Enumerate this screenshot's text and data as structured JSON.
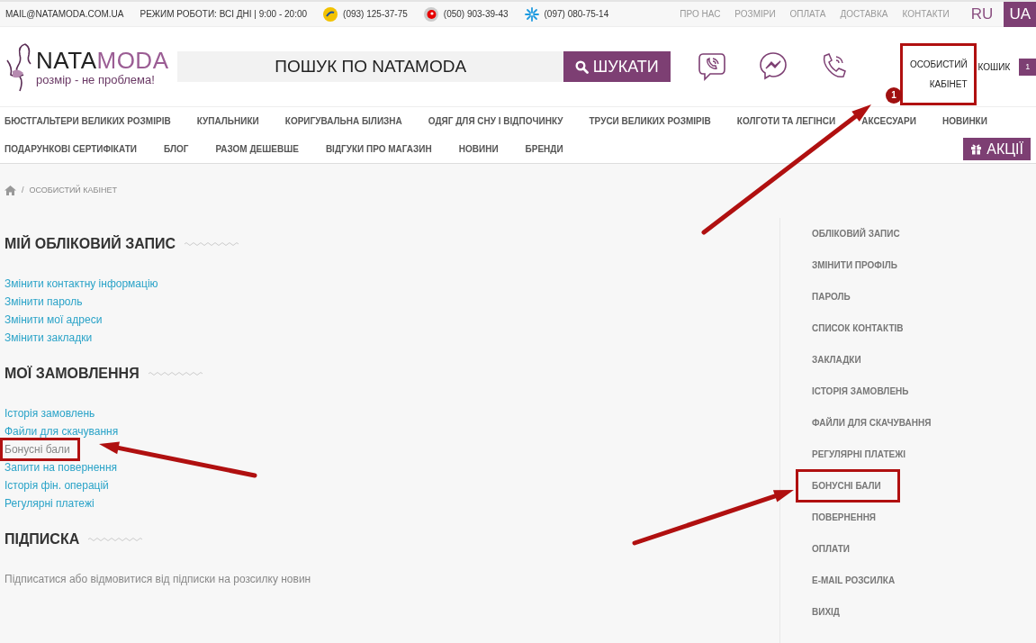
{
  "top_bar": {
    "email": "MAIL@NATAMODA.COM.UA",
    "hours": "РЕЖИМ РОБОТИ: ВСІ ДНІ | 9:00 - 20:00",
    "phones": [
      {
        "kind": "swoosh",
        "number": "(093) 125-37-75"
      },
      {
        "kind": "drop",
        "number": "(050) 903-39-43"
      },
      {
        "kind": "star",
        "number": "(097) 080-75-14"
      }
    ],
    "links": [
      "ПРО НАС",
      "РОЗМІРИ",
      "ОПЛАТА",
      "ДОСТАВКА",
      "КОНТАКТИ"
    ],
    "languages": [
      {
        "label": "RU",
        "selected": false
      },
      {
        "label": "UA",
        "selected": true
      }
    ]
  },
  "header": {
    "logo": {
      "name_start": "NATA",
      "name_end": "MODA",
      "tagline": "розмір - не проблема!"
    },
    "search": {
      "placeholder": "ПОШУК ПО NATAMODA",
      "button": "ШУКАТИ"
    },
    "account_link": {
      "label": "ОСОБИСТИЙ КАБІНЕТ",
      "highlighted": true
    },
    "step_marker": "1",
    "cart": {
      "label": "КОШИК",
      "count": "1"
    }
  },
  "nav": {
    "categories": [
      "БЮСТГАЛЬТЕРИ ВЕЛИКИХ РОЗМІРІВ",
      "КУПАЛЬНИКИ",
      "КОРИГУВАЛЬНА БІЛИЗНА",
      "ОДЯГ ДЛЯ СНУ І ВІДПОЧИНКУ",
      "ТРУСИ ВЕЛИКИХ РОЗМІРІВ",
      "КОЛГОТИ ТА ЛЕГІНСИ",
      "АКСЕСУАРИ",
      "НОВИНКИ"
    ],
    "extra_links": [
      "ПОДАРУНКОВІ СЕРТИФІКАТИ",
      "БЛОГ",
      "РАЗОМ ДЕШЕВШЕ",
      "ВІДГУКИ ПРО МАГАЗИН",
      "НОВИНИ",
      "БРЕНДИ"
    ],
    "promo_button": "АКЦІЇ"
  },
  "breadcrumb": {
    "separator": "/",
    "current": "ОСОБИСТИЙ КАБІНЕТ"
  },
  "sections": [
    {
      "title": "МІЙ ОБЛІКОВИЙ ЗАПИС",
      "links": [
        {
          "label": "Змінити контактну інформацію",
          "selected": false,
          "highlighted": false
        },
        {
          "label": "Змінити пароль",
          "selected": false,
          "highlighted": false
        },
        {
          "label": "Змінити мої адреси",
          "selected": false,
          "highlighted": false
        },
        {
          "label": "Змінити закладки",
          "selected": false,
          "highlighted": false
        }
      ]
    },
    {
      "title": "МОЇ ЗАМОВЛЕННЯ",
      "links": [
        {
          "label": "Історія замовлень",
          "selected": false,
          "highlighted": false
        },
        {
          "label": "Файли для скачування",
          "selected": false,
          "highlighted": false
        },
        {
          "label": "Бонусні бали",
          "selected": true,
          "highlighted": true
        },
        {
          "label": "Запити на повернення",
          "selected": false,
          "highlighted": false
        },
        {
          "label": "Історія фін. операцій",
          "selected": false,
          "highlighted": false
        },
        {
          "label": "Регулярні платежі",
          "selected": false,
          "highlighted": false
        }
      ]
    },
    {
      "title": "ПІДПИСКА",
      "text": "Підписатися або відмовитися від підписки на розсилку новин"
    }
  ],
  "sidebar": [
    {
      "label": "ОБЛІКОВИЙ ЗАПИС",
      "highlighted": false
    },
    {
      "label": "ЗМІНИТИ ПРОФІЛЬ",
      "highlighted": false
    },
    {
      "label": "ПАРОЛЬ",
      "highlighted": false
    },
    {
      "label": "СПИСОК КОНТАКТІВ",
      "highlighted": false
    },
    {
      "label": "ЗАКЛАДКИ",
      "highlighted": false
    },
    {
      "label": "ІСТОРІЯ ЗАМОВЛЕНЬ",
      "highlighted": false
    },
    {
      "label": "ФАЙЛИ ДЛЯ СКАЧУВАННЯ",
      "highlighted": false
    },
    {
      "label": "РЕГУЛЯРНІ ПЛАТЕЖІ",
      "highlighted": false
    },
    {
      "label": "БОНУСНІ БАЛИ",
      "highlighted": true
    },
    {
      "label": "ПОВЕРНЕННЯ",
      "highlighted": false
    },
    {
      "label": "ОПЛАТИ",
      "highlighted": false
    },
    {
      "label": "E-MAIL РОЗСИЛКА",
      "highlighted": false
    },
    {
      "label": "ВИХІД",
      "highlighted": false
    }
  ]
}
